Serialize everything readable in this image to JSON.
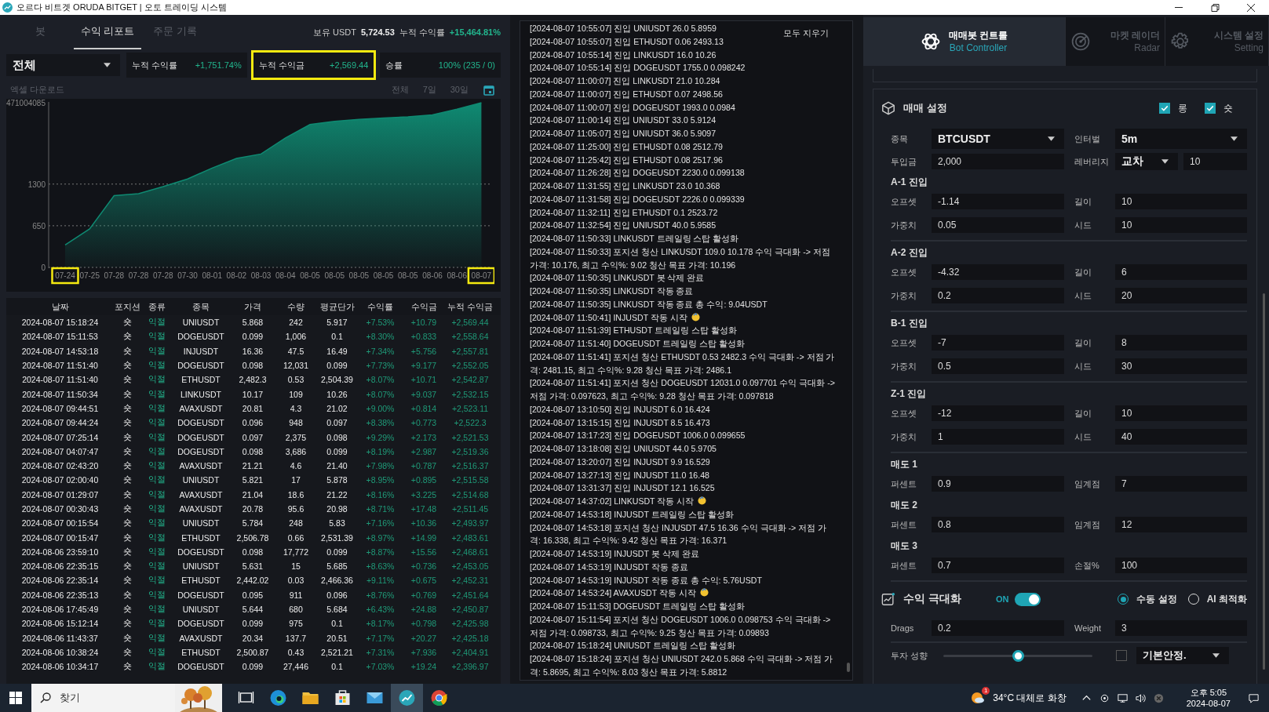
{
  "window": {
    "title": "오르다 비트겟 ORUDA BITGET | 오토 트레이딩 시스템"
  },
  "report": {
    "tabs": [
      {
        "label": "봇",
        "selected": false
      },
      {
        "label": "수익 리포트",
        "selected": true
      },
      {
        "label": "주문 기록",
        "selected": false
      }
    ],
    "summary": [
      {
        "label": "보유 USDT",
        "value": "5,724.53"
      },
      {
        "label": "누적 수익률",
        "value": "+15,464.81%"
      }
    ],
    "filter": {
      "value": "전체"
    },
    "stats": [
      {
        "label": "누적 수익률",
        "value": "+1,751.74%",
        "highlighted": false
      },
      {
        "label": "누적 수익금",
        "value": "+2,569.44",
        "highlighted": true
      },
      {
        "label": "승률",
        "value": "100% (235 / 0)",
        "highlighted": false
      }
    ],
    "excel_link": "엑셀 다운로드",
    "ranges": [
      {
        "label": "전체",
        "selected": false
      },
      {
        "label": "7일",
        "selected": false
      },
      {
        "label": "30일",
        "selected": false
      }
    ],
    "chart_data": {
      "type": "area",
      "categories": [
        "07-24",
        "07-25",
        "07-28",
        "07-28",
        "07-28",
        "07-30",
        "08-01",
        "08-02",
        "08-03",
        "08-04",
        "08-05",
        "08-05",
        "08-05",
        "08-05",
        "08-05",
        "08-06",
        "08-06",
        "08-07"
      ],
      "series": [
        {
          "color": "#0f8a72",
          "values": [
            350,
            600,
            1120,
            1150,
            1260,
            1380,
            1550,
            1700,
            1770,
            2020,
            2230,
            2280,
            2310,
            2330,
            2350,
            2380,
            2470,
            2570
          ]
        }
      ],
      "ylim": [
        0,
        2570
      ],
      "yticks": [
        0,
        650,
        1300
      ]
    },
    "top_label": "471004085",
    "tick_highlighted": [
      true,
      false,
      false,
      false,
      false,
      false,
      false,
      false,
      false,
      false,
      false,
      false,
      false,
      false,
      false,
      false,
      false,
      true
    ],
    "table": {
      "columns": [
        "날짜",
        "포지션",
        "종류",
        "종목",
        "가격",
        "수량",
        "평균단가",
        "수익률",
        "수익금",
        "누적 수익금"
      ],
      "rows": [
        [
          "2024-08-07 15:18:24",
          "숏",
          "익절",
          "UNIUSDT",
          "5.868",
          "242",
          "5.917",
          "+7.53%",
          "+10.79",
          "+2,569.44"
        ],
        [
          "2024-08-07 15:11:53",
          "숏",
          "익절",
          "DOGEUSDT",
          "0.099",
          "1,006",
          "0.1",
          "+8.30%",
          "+0.833",
          "+2,558.64"
        ],
        [
          "2024-08-07 14:53:18",
          "숏",
          "익절",
          "INJUSDT",
          "16.36",
          "47.5",
          "16.49",
          "+7.34%",
          "+5.756",
          "+2,557.81"
        ],
        [
          "2024-08-07 11:51:40",
          "숏",
          "익절",
          "DOGEUSDT",
          "0.098",
          "12,031",
          "0.099",
          "+7.73%",
          "+9.177",
          "+2,552.05"
        ],
        [
          "2024-08-07 11:51:40",
          "숏",
          "익절",
          "ETHUSDT",
          "2,482.3",
          "0.53",
          "2,504.39",
          "+8.07%",
          "+10.71",
          "+2,542.87"
        ],
        [
          "2024-08-07 11:50:34",
          "숏",
          "익절",
          "LINKUSDT",
          "10.17",
          "109",
          "10.26",
          "+8.07%",
          "+9.037",
          "+2,532.15"
        ],
        [
          "2024-08-07 09:44:51",
          "숏",
          "익절",
          "AVAXUSDT",
          "20.81",
          "4.3",
          "21.02",
          "+9.00%",
          "+0.814",
          "+2,523.11"
        ],
        [
          "2024-08-07 09:44:24",
          "숏",
          "익절",
          "DOGEUSDT",
          "0.096",
          "948",
          "0.097",
          "+8.38%",
          "+0.773",
          "+2,522.3"
        ],
        [
          "2024-08-07 07:25:14",
          "숏",
          "익절",
          "DOGEUSDT",
          "0.097",
          "2,375",
          "0.098",
          "+9.29%",
          "+2.173",
          "+2,521.53"
        ],
        [
          "2024-08-07 04:07:47",
          "숏",
          "익절",
          "DOGEUSDT",
          "0.098",
          "3,686",
          "0.099",
          "+8.19%",
          "+2.987",
          "+2,519.36"
        ],
        [
          "2024-08-07 02:43:20",
          "숏",
          "익절",
          "AVAXUSDT",
          "21.21",
          "4.6",
          "21.40",
          "+7.98%",
          "+0.787",
          "+2,516.37"
        ],
        [
          "2024-08-07 02:00:40",
          "숏",
          "익절",
          "UNIUSDT",
          "5.821",
          "17",
          "5.878",
          "+8.95%",
          "+0.895",
          "+2,515.58"
        ],
        [
          "2024-08-07 01:29:07",
          "숏",
          "익절",
          "AVAXUSDT",
          "21.04",
          "18.6",
          "21.22",
          "+8.16%",
          "+3.225",
          "+2,514.68"
        ],
        [
          "2024-08-07 00:30:43",
          "숏",
          "익절",
          "AVAXUSDT",
          "20.78",
          "95.6",
          "20.98",
          "+8.71%",
          "+17.48",
          "+2,511.45"
        ],
        [
          "2024-08-07 00:15:54",
          "숏",
          "익절",
          "UNIUSDT",
          "5.784",
          "248",
          "5.83",
          "+7.16%",
          "+10.36",
          "+2,493.97"
        ],
        [
          "2024-08-07 00:15:47",
          "숏",
          "익절",
          "ETHUSDT",
          "2,506.78",
          "0.66",
          "2,531.39",
          "+8.97%",
          "+14.99",
          "+2,483.61"
        ],
        [
          "2024-08-06 23:59:10",
          "숏",
          "익절",
          "DOGEUSDT",
          "0.098",
          "17,772",
          "0.099",
          "+8.87%",
          "+15.56",
          "+2,468.61"
        ],
        [
          "2024-08-06 22:35:15",
          "숏",
          "익절",
          "UNIUSDT",
          "5.631",
          "15",
          "5.685",
          "+8.63%",
          "+0.736",
          "+2,453.05"
        ],
        [
          "2024-08-06 22:35:14",
          "숏",
          "익절",
          "ETHUSDT",
          "2,442.02",
          "0.03",
          "2,466.36",
          "+9.11%",
          "+0.675",
          "+2,452.31"
        ],
        [
          "2024-08-06 22:35:13",
          "숏",
          "익절",
          "DOGEUSDT",
          "0.095",
          "911",
          "0.096",
          "+8.76%",
          "+0.769",
          "+2,451.64"
        ],
        [
          "2024-08-06 17:45:49",
          "숏",
          "익절",
          "UNIUSDT",
          "5.644",
          "680",
          "5.684",
          "+6.43%",
          "+24.88",
          "+2,450.87"
        ],
        [
          "2024-08-06 15:12:14",
          "숏",
          "익절",
          "DOGEUSDT",
          "0.099",
          "975",
          "0.1",
          "+8.17%",
          "+0.798",
          "+2,425.98"
        ],
        [
          "2024-08-06 11:43:37",
          "숏",
          "익절",
          "AVAXUSDT",
          "20.34",
          "137.7",
          "20.51",
          "+7.17%",
          "+20.27",
          "+2,425.18"
        ],
        [
          "2024-08-06 10:38:24",
          "숏",
          "익절",
          "ETHUSDT",
          "2,500.87",
          "0.43",
          "2,521.21",
          "+7.31%",
          "+7.936",
          "+2,404.91"
        ],
        [
          "2024-08-06 10:34:17",
          "숏",
          "익절",
          "DOGEUSDT",
          "0.099",
          "27,446",
          "0.1",
          "+7.03%",
          "+19.24",
          "+2,396.97"
        ]
      ]
    }
  },
  "log": {
    "clear_button": "모두 지우기",
    "lines": [
      {
        "text": "[2024-08-07 10:55:07] 진입 UNIUSDT 26.0 5.8959",
        "emoji": false
      },
      {
        "text": "[2024-08-07 10:55:07] 진입 ETHUSDT 0.06 2493.13",
        "emoji": false
      },
      {
        "text": "[2024-08-07 10:55:14] 진입 LINKUSDT 16.0 10.26",
        "emoji": false
      },
      {
        "text": "[2024-08-07 10:55:14] 진입 DOGEUSDT 1755.0 0.098242",
        "emoji": false
      },
      {
        "text": "[2024-08-07 11:00:07] 진입 LINKUSDT 21.0 10.284",
        "emoji": false
      },
      {
        "text": "[2024-08-07 11:00:07] 진입 ETHUSDT 0.07 2498.56",
        "emoji": false
      },
      {
        "text": "[2024-08-07 11:00:07] 진입 DOGEUSDT 1993.0 0.0984",
        "emoji": false
      },
      {
        "text": "[2024-08-07 11:00:14] 진입 UNIUSDT 33.0 5.9124",
        "emoji": false
      },
      {
        "text": "[2024-08-07 11:05:07] 진입 UNIUSDT 36.0 5.9097",
        "emoji": false
      },
      {
        "text": "[2024-08-07 11:25:00] 진입 ETHUSDT 0.08 2512.79",
        "emoji": false
      },
      {
        "text": "[2024-08-07 11:25:42] 진입 ETHUSDT 0.08 2517.96",
        "emoji": false
      },
      {
        "text": "[2024-08-07 11:26:28] 진입 DOGEUSDT 2230.0 0.099138",
        "emoji": false
      },
      {
        "text": "[2024-08-07 11:31:55] 진입 LINKUSDT 23.0 10.368",
        "emoji": false
      },
      {
        "text": "[2024-08-07 11:31:58] 진입 DOGEUSDT 2226.0 0.099339",
        "emoji": false
      },
      {
        "text": "[2024-08-07 11:32:11] 진입 ETHUSDT 0.1 2523.72",
        "emoji": false
      },
      {
        "text": "[2024-08-07 11:32:54] 진입 UNIUSDT 40.0 5.9585",
        "emoji": false
      },
      {
        "text": "[2024-08-07 11:50:33] LINKUSDT 트레일링 스탑 활성화",
        "emoji": false
      },
      {
        "text": "[2024-08-07 11:50:33] 포지션 청산 LINKUSDT 109.0 10.178 수익 극대화 -> 저점 가격: 10.176, 최고 수익%: 9.02 청산 목표 가격: 10.196",
        "emoji": false
      },
      {
        "text": "[2024-08-07 11:50:35] LINKUSDT 봇 삭제 완료",
        "emoji": false
      },
      {
        "text": "[2024-08-07 11:50:35] LINKUSDT 작동 종료",
        "emoji": false
      },
      {
        "text": "[2024-08-07 11:50:35] LINKUSDT 작동 종료 총 수익: 9.04USDT",
        "emoji": false
      },
      {
        "text": "[2024-08-07 11:50:41] INJUSDT 작동 시작",
        "emoji": true
      },
      {
        "text": "[2024-08-07 11:51:39] ETHUSDT 트레일링 스탑 활성화",
        "emoji": false
      },
      {
        "text": "[2024-08-07 11:51:40] DOGEUSDT 트레일링 스탑 활성화",
        "emoji": false
      },
      {
        "text": "[2024-08-07 11:51:41] 포지션 청산 ETHUSDT 0.53 2482.3 수익 극대화 -> 저점 가격: 2481.15, 최고 수익%: 9.28 청산 목표 가격: 2486.1",
        "emoji": false
      },
      {
        "text": "[2024-08-07 11:51:41] 포지션 청산 DOGEUSDT 12031.0 0.097701 수익 극대화 -> 저점 가격: 0.097623, 최고 수익%: 9.28 청산 목표 가격: 0.097818",
        "emoji": false
      },
      {
        "text": "[2024-08-07 13:10:50] 진입 INJUSDT 6.0 16.424",
        "emoji": false
      },
      {
        "text": "[2024-08-07 13:15:15] 진입 INJUSDT 8.5 16.473",
        "emoji": false
      },
      {
        "text": "[2024-08-07 13:17:23] 진입 DOGEUSDT 1006.0 0.099655",
        "emoji": false
      },
      {
        "text": "[2024-08-07 13:18:08] 진입 UNIUSDT 44.0 5.9705",
        "emoji": false
      },
      {
        "text": "[2024-08-07 13:20:07] 진입 INJUSDT 9.9 16.529",
        "emoji": false
      },
      {
        "text": "[2024-08-07 13:27:13] 진입 INJUSDT 11.0 16.48",
        "emoji": false
      },
      {
        "text": "[2024-08-07 13:31:37] 진입 INJUSDT 12.1 16.525",
        "emoji": false
      },
      {
        "text": "[2024-08-07 14:37:02] LINKUSDT 작동 시작",
        "emoji": true
      },
      {
        "text": "[2024-08-07 14:53:18] INJUSDT 트레일링 스탑 활성화",
        "emoji": false
      },
      {
        "text": "[2024-08-07 14:53:18] 포지션 청산 INJUSDT 47.5 16.36 수익 극대화 -> 저점 가격: 16.338, 최고 수익%: 9.42 청산 목표 가격: 16.371",
        "emoji": false
      },
      {
        "text": "[2024-08-07 14:53:19] INJUSDT 봇 삭제 완료",
        "emoji": false
      },
      {
        "text": "[2024-08-07 14:53:19] INJUSDT 작동 종료",
        "emoji": false
      },
      {
        "text": "[2024-08-07 14:53:19] INJUSDT 작동 종료 총 수익: 5.76USDT",
        "emoji": false
      },
      {
        "text": "[2024-08-07 14:53:24] AVAXUSDT 작동 시작",
        "emoji": true
      },
      {
        "text": "[2024-08-07 15:11:53] DOGEUSDT 트레일링 스탑 활성화",
        "emoji": false
      },
      {
        "text": "[2024-08-07 15:11:54] 포지션 청산 DOGEUSDT 1006.0 0.098753 수익 극대화 -> 저점 가격: 0.098733, 최고 수익%: 9.25 청산 목표 가격: 0.09893",
        "emoji": false
      },
      {
        "text": "[2024-08-07 15:18:24] UNIUSDT 트레일링 스탑 활성화",
        "emoji": false
      },
      {
        "text": "[2024-08-07 15:18:24] 포지션 청산 UNIUSDT 242.0 5.868 수익 극대화 -> 저점 가격: 5.8695, 최고 수익%: 8.03 청산 목표 가격: 5.8812",
        "emoji": false
      }
    ]
  },
  "controller": {
    "tabs": [
      {
        "title": "매매봇 컨트롤",
        "subtitle": "Bot Controller",
        "selected": true
      },
      {
        "title": "마켓 레이더",
        "subtitle": "Radar",
        "selected": false
      },
      {
        "title": "시스템 설정",
        "subtitle": "Setting",
        "selected": false
      }
    ],
    "settings": {
      "title": "매매 설정",
      "sides": [
        {
          "label": "롱",
          "checked": true
        },
        {
          "label": "숏",
          "checked": true
        }
      ],
      "symbol": {
        "label": "종목",
        "value": "BTCUSDT"
      },
      "interval": {
        "label": "인터벌",
        "value": "5m"
      },
      "amount": {
        "label": "투입금",
        "value": "2,000"
      },
      "leverage": {
        "label": "레버리지",
        "mode": "교차",
        "value": "10"
      },
      "groups": [
        {
          "title": "A-1 진입",
          "divider": true,
          "fields": [
            {
              "label": "오프셋",
              "value": "-1.14"
            },
            {
              "label": "길이",
              "value": "10"
            },
            {
              "label": "가중치",
              "value": "0.05"
            },
            {
              "label": "시드",
              "value": "10"
            }
          ]
        },
        {
          "title": "A-2 진입",
          "divider": true,
          "fields": [
            {
              "label": "오프셋",
              "value": "-4.32"
            },
            {
              "label": "길이",
              "value": "6"
            },
            {
              "label": "가중치",
              "value": "0.2"
            },
            {
              "label": "시드",
              "value": "20"
            }
          ]
        },
        {
          "title": "B-1 진입",
          "divider": true,
          "fields": [
            {
              "label": "오프셋",
              "value": "-7"
            },
            {
              "label": "길이",
              "value": "8"
            },
            {
              "label": "가중치",
              "value": "0.5"
            },
            {
              "label": "시드",
              "value": "30"
            }
          ]
        },
        {
          "title": "Z-1 진입",
          "divider": true,
          "fields": [
            {
              "label": "오프셋",
              "value": "-12"
            },
            {
              "label": "길이",
              "value": "10"
            },
            {
              "label": "가중치",
              "value": "1"
            },
            {
              "label": "시드",
              "value": "40"
            }
          ]
        },
        {
          "title": "매도 1",
          "divider": false,
          "fields": [
            {
              "label": "퍼센트",
              "value": "0.9"
            },
            {
              "label": "임계점",
              "value": "7"
            }
          ]
        },
        {
          "title": "매도 2",
          "divider": false,
          "fields": [
            {
              "label": "퍼센트",
              "value": "0.8"
            },
            {
              "label": "임계점",
              "value": "12"
            }
          ]
        },
        {
          "title": "매도 3",
          "divider": true,
          "fields": [
            {
              "label": "퍼센트",
              "value": "0.7"
            },
            {
              "label": "손절%",
              "value": "100"
            }
          ]
        }
      ]
    },
    "maximize": {
      "title": "수익 극대화",
      "on_label": "ON",
      "on": true,
      "modes": [
        {
          "label": "수동 설정",
          "selected": true
        },
        {
          "label": "AI 최적화",
          "selected": false
        }
      ],
      "fields": [
        {
          "label": "Drags",
          "value": "0.2"
        },
        {
          "label": "Weight",
          "value": "3"
        }
      ]
    },
    "risk": {
      "label": "투자 성향",
      "level": 0.5,
      "checked": false,
      "preset": "기본안정."
    }
  },
  "taskbar": {
    "search_placeholder": "찾기",
    "weather_badge": "1",
    "weather": "34°C 대체로 화창",
    "time": "오후 5:05",
    "date": "2024-08-07"
  }
}
